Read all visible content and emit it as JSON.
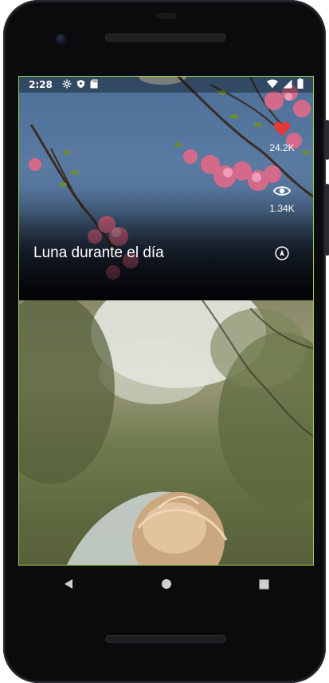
{
  "status_bar": {
    "time": "2:28",
    "left_icons": [
      "settings-icon",
      "shield-icon",
      "sd-card-icon"
    ],
    "right_icons": [
      "wifi-icon",
      "signal-icon",
      "battery-icon"
    ]
  },
  "feed": {
    "cards": [
      {
        "title": "Luna durante el día",
        "likes": "24.2K",
        "views": "1.34K",
        "liked": true,
        "like_color": "#e53935"
      },
      {
        "title": ""
      }
    ]
  },
  "nav_bar": {
    "buttons": [
      "back-icon",
      "home-icon",
      "recents-icon"
    ]
  },
  "colors": {
    "accent_outline": "#9bd64a"
  }
}
